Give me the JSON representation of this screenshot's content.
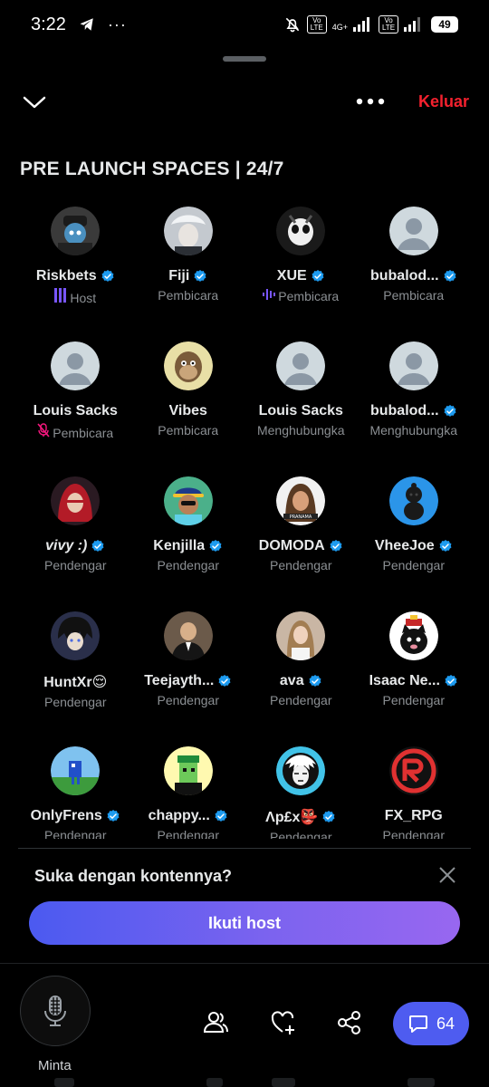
{
  "status_bar": {
    "time": "3:22",
    "battery": "49",
    "network": "4G+",
    "volte_label": "Vo LTE"
  },
  "header": {
    "leave_label": "Keluar",
    "space_title": "PRE LAUNCH SPACES | 24/7"
  },
  "colors": {
    "accent": "#4e5cf0",
    "leave": "#f4212e",
    "verified": "#1d9bf0",
    "host": "#7856ff"
  },
  "participants": [
    {
      "name": "Riskbets",
      "role": "Host",
      "verified": true,
      "role_icon": "host-bars-icon",
      "avatar": "dark-hood"
    },
    {
      "name": "Fiji",
      "role": "Pembicara",
      "verified": true,
      "role_icon": "",
      "avatar": "white-hair"
    },
    {
      "name": "XUE",
      "role": "Pembicara",
      "verified": true,
      "role_icon": "speaking-wave-icon",
      "avatar": "panda-mask"
    },
    {
      "name": "bubalod...",
      "role": "Pembicara",
      "verified": true,
      "role_icon": "",
      "avatar": "default"
    },
    {
      "name": "Louis Sacks",
      "role": "Pembicara",
      "verified": false,
      "role_icon": "muted-mic-icon",
      "avatar": "default"
    },
    {
      "name": "Vibes",
      "role": "Pembicara",
      "verified": false,
      "role_icon": "",
      "avatar": "ape"
    },
    {
      "name": "Louis Sacks",
      "role": "Menghubungka",
      "verified": false,
      "role_icon": "",
      "avatar": "default"
    },
    {
      "name": "bubalod...",
      "role": "Menghubungka",
      "verified": true,
      "role_icon": "",
      "avatar": "default"
    },
    {
      "name": "vivy :)",
      "role": "Pendengar",
      "verified": true,
      "role_icon": "",
      "avatar": "red-hood",
      "italic": true
    },
    {
      "name": "Kenjilla",
      "role": "Pendengar",
      "verified": true,
      "role_icon": "",
      "avatar": "cartoon-cap"
    },
    {
      "name": "DOMODA",
      "role": "Pendengar",
      "verified": true,
      "role_icon": "",
      "avatar": "long-hair"
    },
    {
      "name": "VheeJoe",
      "role": "Pendengar",
      "verified": true,
      "role_icon": "",
      "avatar": "blue-figure"
    },
    {
      "name": "HuntXr😌",
      "role": "Pendengar",
      "verified": false,
      "role_icon": "",
      "avatar": "anime-dark"
    },
    {
      "name": "Teejayth...",
      "role": "Pendengar",
      "verified": true,
      "role_icon": "",
      "avatar": "suit"
    },
    {
      "name": "ava",
      "role": "Pendengar",
      "verified": true,
      "role_icon": "",
      "avatar": "selfie"
    },
    {
      "name": "Isaac Ne...",
      "role": "Pendengar",
      "verified": true,
      "role_icon": "",
      "avatar": "cat-hat"
    },
    {
      "name": "OnlyFrens",
      "role": "Pendengar",
      "verified": true,
      "role_icon": "",
      "avatar": "pixel-field"
    },
    {
      "name": "chappy...",
      "role": "Pendengar",
      "verified": true,
      "role_icon": "",
      "avatar": "pixel-green"
    },
    {
      "name": "Λp£x👺",
      "role": "Pendengar",
      "verified": true,
      "role_icon": "",
      "avatar": "sketch"
    },
    {
      "name": "FX_RPG",
      "role": "Pendengar",
      "verified": false,
      "role_icon": "",
      "avatar": "red-r-logo"
    }
  ],
  "follow_prompt": {
    "title": "Suka dengan kontennya?",
    "button_label": "Ikuti host"
  },
  "bottom_bar": {
    "mic_label": "Minta",
    "comment_count": "64"
  }
}
